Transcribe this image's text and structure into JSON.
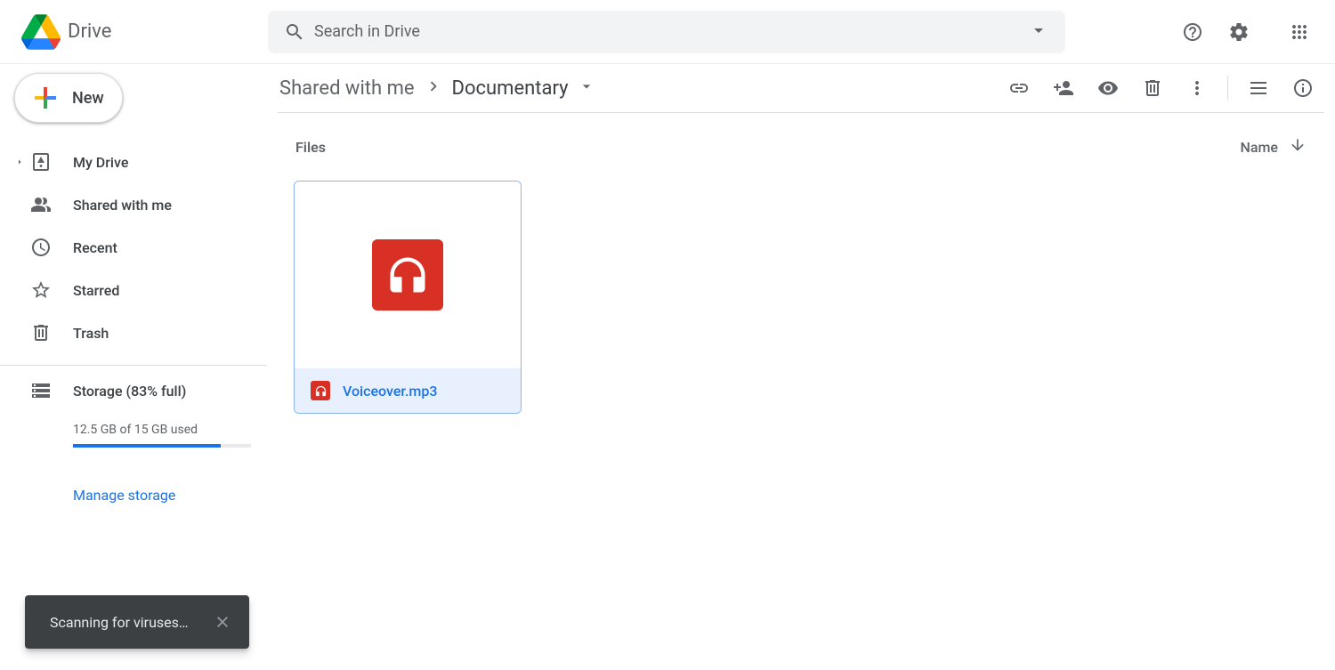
{
  "header": {
    "brand": "Drive",
    "search_placeholder": "Search in Drive"
  },
  "new_button": {
    "label": "New"
  },
  "sidebar": {
    "items": [
      {
        "label": "My Drive",
        "icon": "my-drive",
        "expandable": true
      },
      {
        "label": "Shared with me",
        "icon": "shared",
        "expandable": false
      },
      {
        "label": "Recent",
        "icon": "recent",
        "expandable": false
      },
      {
        "label": "Starred",
        "icon": "starred",
        "expandable": false
      },
      {
        "label": "Trash",
        "icon": "trash",
        "expandable": false
      }
    ]
  },
  "storage": {
    "label": "Storage (83% full)",
    "used": "12.5 GB of 15 GB used",
    "percent": 83,
    "manage_label": "Manage storage"
  },
  "breadcrumb": {
    "parent": "Shared with me",
    "current": "Documentary"
  },
  "section": {
    "title": "Files",
    "sort_label": "Name"
  },
  "files": [
    {
      "name": "Voiceover.mp3",
      "type": "audio",
      "selected": true
    }
  ],
  "toast": {
    "message": "Scanning for viruses…"
  }
}
